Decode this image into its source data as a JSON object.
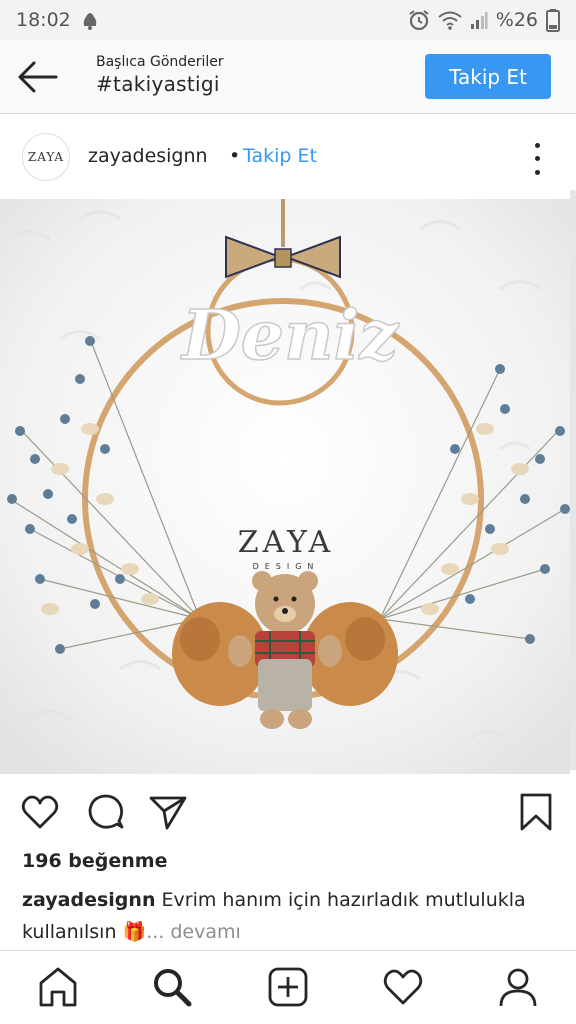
{
  "status_bar": {
    "time": "18:02",
    "battery": "%26",
    "icons": [
      "notification-icon",
      "alarm-icon",
      "wifi-icon",
      "signal-icon"
    ]
  },
  "header": {
    "subtitle": "Başlıca Gönderiler",
    "title": "#takiyastigi",
    "follow_label": "Takip Et",
    "back_icon": "back-arrow-icon"
  },
  "post": {
    "avatar_text": "ZAYA",
    "username": "zayadesignn",
    "separator": "•",
    "follow_label": "Takip Et",
    "image": {
      "name_text": "Deniz",
      "brand_text": "ZAYA",
      "brand_sub": "DESIGN"
    },
    "likes": "196 beğenme",
    "caption_user": "zayadesignn",
    "caption_text": "Evrim hanım için hazırladık mutlulukla kullanılsın 🎁",
    "caption_more": "... devamı"
  },
  "actions": [
    "like-icon",
    "comment-icon",
    "share-icon",
    "save-icon"
  ],
  "bottom_nav": [
    "home-icon",
    "search-icon",
    "add-post-icon",
    "activity-icon",
    "profile-icon"
  ],
  "colors": {
    "accent": "#3897f0",
    "text": "#262626",
    "muted": "#8e8e8e"
  }
}
